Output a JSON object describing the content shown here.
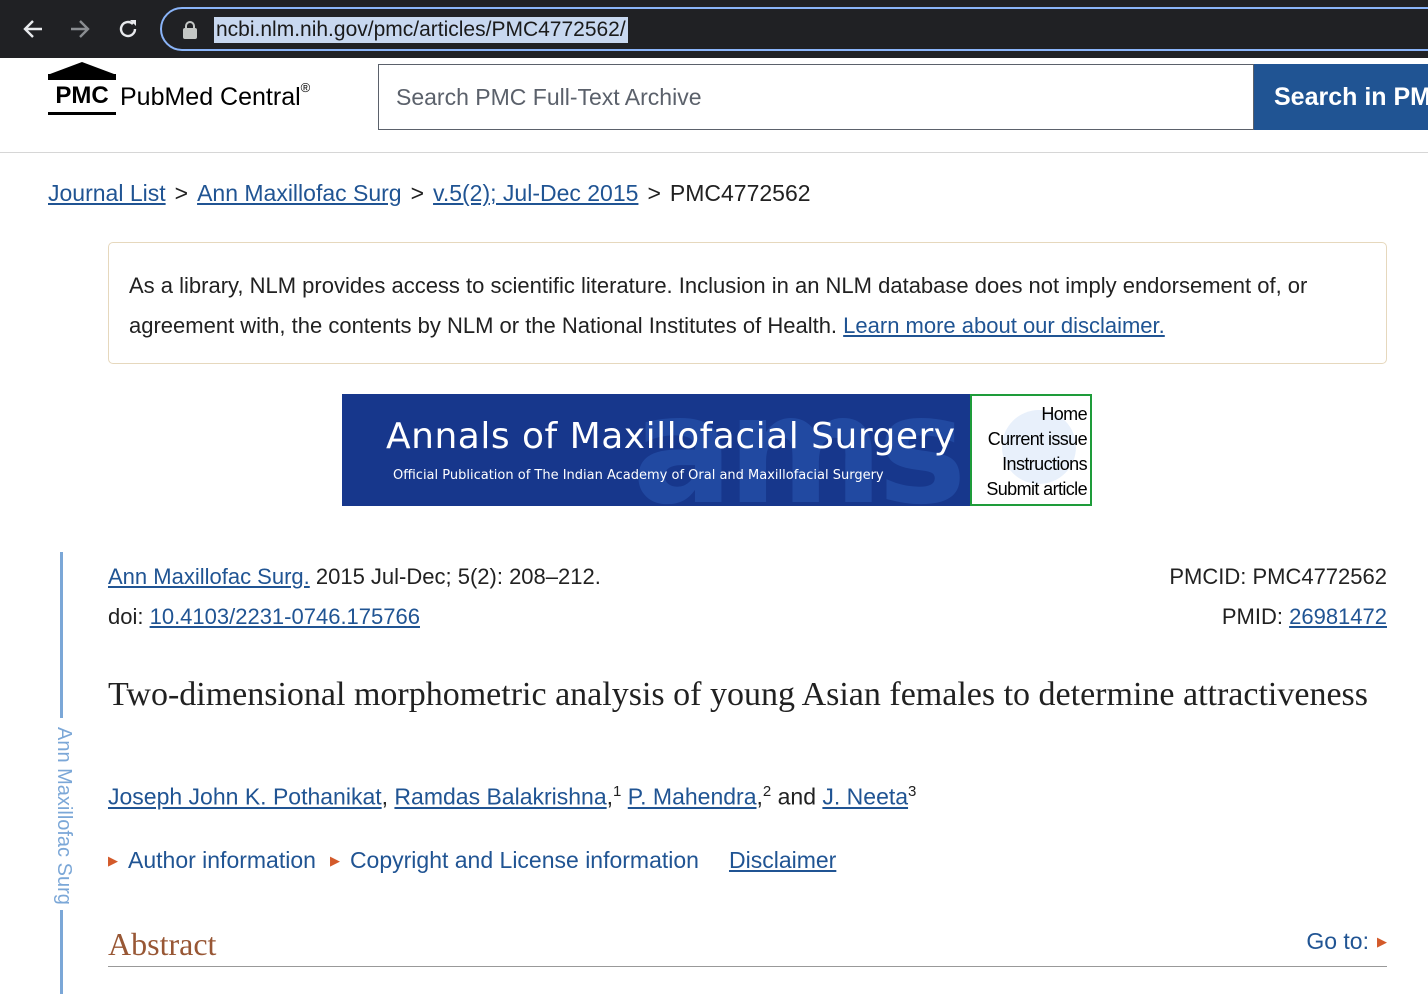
{
  "browser": {
    "url": "ncbi.nlm.nih.gov/pmc/articles/PMC4772562/",
    "icons": [
      "back-icon",
      "forward-icon",
      "reload-icon",
      "lock-icon"
    ]
  },
  "header": {
    "logo_abbr": "PMC",
    "logo_name": "PubMed Central",
    "logo_reg": "®",
    "search_placeholder": "Search PMC Full-Text Archive",
    "search_button": "Search in PMC"
  },
  "breadcrumb": {
    "items": [
      "Journal List",
      "Ann Maxillofac Surg",
      "v.5(2); Jul-Dec 2015"
    ],
    "separator": ">",
    "current": "PMC4772562"
  },
  "disclaimer": {
    "text": "As a library, NLM provides access to scientific literature. Inclusion in an NLM database does not imply endorsement of, or agreement with, the contents by NLM or the National Institutes of Health. ",
    "link": "Learn more about our disclaimer."
  },
  "banner": {
    "title": "Annals of Maxillofacial Surgery",
    "subtitle": "Official Publication of The Indian Academy of Oral and Maxillofacial Surgery",
    "watermark": "ams",
    "links": [
      "Home",
      "Current issue",
      "Instructions",
      "Submit article"
    ]
  },
  "sidebar": {
    "journal_label": "Ann Maxillofac Surg"
  },
  "citation": {
    "journal": "Ann Maxillofac Surg.",
    "details": " 2015 Jul-Dec; 5(2): 208–212.",
    "doi_label": "doi: ",
    "doi": "10.4103/2231-0746.175766",
    "pmcid_label": "PMCID: ",
    "pmcid": "PMC4772562",
    "pmid_label": "PMID: ",
    "pmid": "26981472"
  },
  "article": {
    "title": "Two-dimensional morphometric analysis of young Asian females to determine attractiveness",
    "authors": [
      {
        "name": "Joseph John K. Pothanikat",
        "sup": ""
      },
      {
        "name": "Ramdas Balakrishna",
        "sup": "1"
      },
      {
        "name": "P. Mahendra",
        "sup": "2"
      },
      {
        "name": "J. Neeta",
        "sup": "3"
      }
    ],
    "and": " and ",
    "info_links": [
      "Author information",
      "Copyright and License information"
    ],
    "disclaimer_link": "Disclaimer"
  },
  "abstract": {
    "heading": "Abstract",
    "goto": "Go to:"
  },
  "colors": {
    "chrome_bg": "#202124",
    "link": "#205493",
    "button_bg": "#205493",
    "abstract_heading": "#985735",
    "banner_bg": "#17378c",
    "arrow": "#d35a2a"
  }
}
